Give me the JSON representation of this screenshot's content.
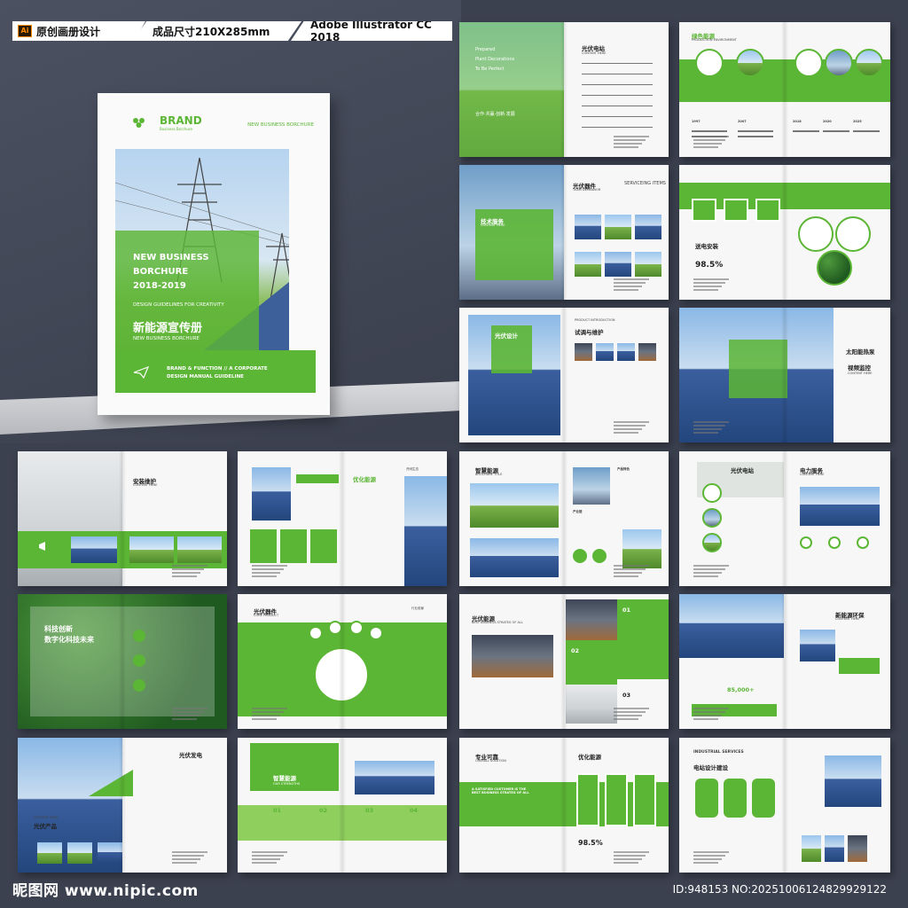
{
  "header": {
    "label1": "原创画册设计",
    "ai_badge": "Ai",
    "label2": "成品尺寸210X285mm",
    "label3": "Adobe Illustrator CC 2018"
  },
  "cover": {
    "brand": "BRAND",
    "brand_sub": "Business Borchure",
    "tag": "NEW BUSINESS BORCHURE",
    "title1": "NEW BUSINESS",
    "title2": "BORCHURE",
    "years": "2018-2019",
    "guidelines": "DESIGN GUIDELINES FOR CREATIVITY",
    "cn_title": "新能源宣传册",
    "cn_sub": "NEW BUSINESS BORCHURE",
    "band1": "BRAND & FUNCTION  // A CORPORATE",
    "band2": "DESIGN MANUAL GUIDELINE"
  },
  "spreads": {
    "s1": {
      "p1": "Prepared",
      "p2": "Plant Decorations",
      "p3": "To Be Perfect",
      "slogan": "合作·共赢·创新·发展",
      "toc": "光伏电站",
      "toc_en": "CONTENT HERE"
    },
    "s2": {
      "title": "绿色能源",
      "en": "PRODUCTION ENVIRONMENT",
      "years": [
        "1997",
        "2007",
        "2018",
        "2020",
        "2025"
      ]
    },
    "s3": {
      "title": "技术服务",
      "en": "CONTENT HERE",
      "title2": "光伏器件",
      "en2": "TEAM DEMEANOR",
      "side": "SERVICEING ITEMS"
    },
    "s4": {
      "title": "送电安装",
      "percent": "98.5%"
    },
    "s5": {
      "title": "光伏设计",
      "title2": "试调与维护",
      "en": "PRODUCT INTRODUCTION"
    },
    "s6": {
      "title": "太阳能热泵",
      "title2": "视频监控",
      "en": "CONTENT HERE"
    },
    "s7": {
      "title": "安装维护",
      "en": "CONTENT HERE"
    },
    "s8": {
      "title": "优化能源",
      "label": "开阔生态"
    },
    "s9": {
      "title": "智慧能源",
      "en": "BROCHURE TITLE",
      "t2": "产品特色",
      "t3": "产业链"
    },
    "s10": {
      "title": "光伏电站",
      "title2": "电力服务",
      "en": "CONTENT HERE"
    },
    "s11": {
      "line1": "科技创新",
      "line2": "数字化科技未来"
    },
    "s12": {
      "title": "光伏器件",
      "en": "CORE PRODUCT",
      "tag": "行业前景"
    },
    "s13": {
      "title": "光伏能源",
      "en": "BEST BUSINESS STRATEG OF ALL",
      "n1": "01",
      "n2": "02",
      "n3": "03"
    },
    "s14": {
      "title": "新能源环保",
      "en": "CONTENT HERE",
      "stat": "85,000+"
    },
    "s15": {
      "title": "光伏发电",
      "cn": "光伏产品",
      "en": "CONTENT HERE"
    },
    "s16": {
      "title": "智慧能源",
      "en": "OUR STRENGTHS",
      "nums": [
        "01",
        "02",
        "03",
        "04"
      ]
    },
    "s17": {
      "title": "专业可靠",
      "en": "OVERALL SOLUTION",
      "title2": "优化能源",
      "quote": "A SATISFIED CUSTOMER IS THE BEST BUSINESS STRATEG OF ALL",
      "percent": "98.5%"
    },
    "s18": {
      "en": "INDUSTRIAL SERVICES",
      "title": "电站设计建设"
    }
  },
  "footer": {
    "site": "昵图网 www.nipic.com",
    "id": "ID:948153 NO:20251006124829929122"
  },
  "colors": {
    "accent": "#5cb635",
    "background": "#3c4150"
  }
}
